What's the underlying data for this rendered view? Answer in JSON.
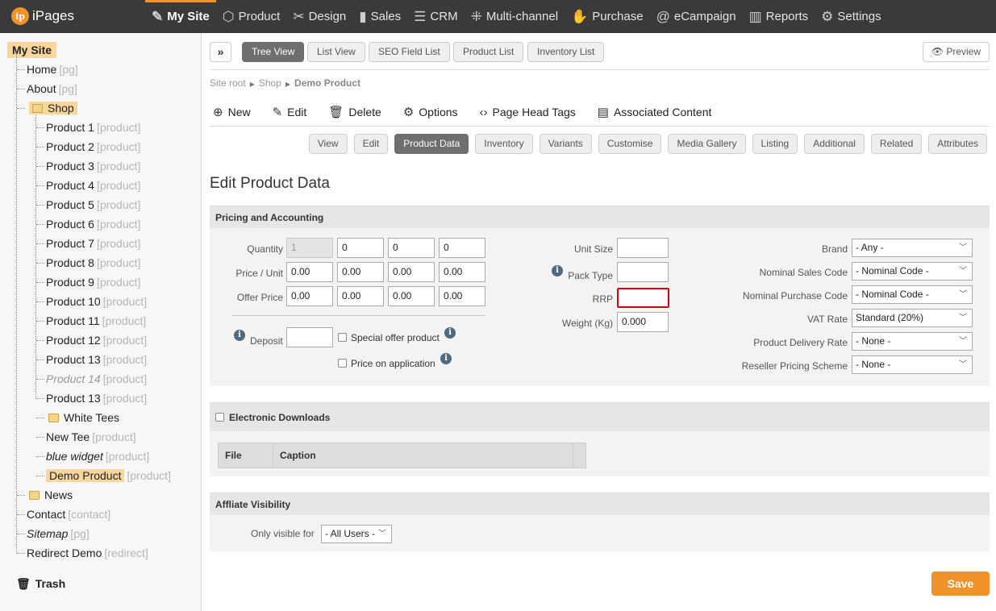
{
  "app": {
    "logo_text": "iPages",
    "logo_mark": "ip",
    "accent": "#f0922a"
  },
  "nav": [
    {
      "label": "My Site",
      "icon": "my-site-icon",
      "glyph": "✎",
      "active": true
    },
    {
      "label": "Product",
      "icon": "box-icon",
      "glyph": "⬡"
    },
    {
      "label": "Design",
      "icon": "brush-icon",
      "glyph": "✂"
    },
    {
      "label": "Sales",
      "icon": "bar-chart-icon",
      "glyph": "▮"
    },
    {
      "label": "CRM",
      "icon": "contact-card-icon",
      "glyph": "☰"
    },
    {
      "label": "Multi-channel",
      "icon": "network-icon",
      "glyph": "⁜"
    },
    {
      "label": "Purchase",
      "icon": "handshake-icon",
      "glyph": "✋"
    },
    {
      "label": "eCampaign",
      "icon": "at-icon",
      "glyph": "@"
    },
    {
      "label": "Reports",
      "icon": "reports-icon",
      "glyph": "▥"
    },
    {
      "label": "Settings",
      "icon": "gear-icon",
      "glyph": "⚙"
    }
  ],
  "tree": {
    "root": "My Site",
    "nodes": [
      {
        "label": "Home",
        "tag": "[pg]"
      },
      {
        "label": "About",
        "tag": "[pg]"
      },
      {
        "label": "Shop",
        "tag": ""
      },
      {
        "label": "Product 1",
        "tag": "[product]"
      },
      {
        "label": "Product 2",
        "tag": "[product]"
      },
      {
        "label": "Product 3",
        "tag": "[product]"
      },
      {
        "label": "Product 4",
        "tag": "[product]"
      },
      {
        "label": "Product 5",
        "tag": "[product]"
      },
      {
        "label": "Product 6",
        "tag": "[product]"
      },
      {
        "label": "Product 7",
        "tag": "[product]"
      },
      {
        "label": "Product 8",
        "tag": "[product]"
      },
      {
        "label": "Product 9",
        "tag": "[product]"
      },
      {
        "label": "Product 10",
        "tag": "[product]"
      },
      {
        "label": "Product 11",
        "tag": "[product]"
      },
      {
        "label": "Product 12",
        "tag": "[product]"
      },
      {
        "label": "Product 13",
        "tag": "[product]"
      },
      {
        "label": "Product 14",
        "tag": "[product]"
      },
      {
        "label": "Product 13",
        "tag": "[product]"
      },
      {
        "label": "White Tees",
        "tag": ""
      },
      {
        "label": "New Tee",
        "tag": "[product]"
      },
      {
        "label": "blue widget",
        "tag": "[product]"
      },
      {
        "label": "Demo Product",
        "tag": "[product]"
      },
      {
        "label": "News",
        "tag": ""
      },
      {
        "label": "Contact",
        "tag": "[contact]"
      },
      {
        "label": "Sitemap",
        "tag": "[pg]"
      },
      {
        "label": "Redirect Demo",
        "tag": "[redirect]"
      }
    ],
    "trash": "Trash"
  },
  "view_tabs": [
    "Tree View",
    "List View",
    "SEO Field List",
    "Product List",
    "Inventory List"
  ],
  "preview": "Preview",
  "breadcrumb": [
    "Site root",
    "Shop",
    "Demo Product"
  ],
  "actions": [
    {
      "label": "New",
      "glyph": "⊕"
    },
    {
      "label": "Edit",
      "glyph": "✎"
    },
    {
      "label": "Delete",
      "glyph": "🗑"
    },
    {
      "label": "Options",
      "glyph": "⚙"
    },
    {
      "label": "Page Head Tags",
      "glyph": "‹›"
    },
    {
      "label": "Associated Content",
      "glyph": "▤"
    }
  ],
  "sub_tabs": [
    "View",
    "Edit",
    "Product Data",
    "Inventory",
    "Variants",
    "Customise",
    "Media Gallery",
    "Listing",
    "Additional",
    "Related",
    "Attributes"
  ],
  "page_title": "Edit Product Data",
  "pricing": {
    "heading": "Pricing and Accounting",
    "quantity_label": "Quantity",
    "price_label": "Price / Unit",
    "offer_label": "Offer Price",
    "quantity": [
      "1",
      "0",
      "0",
      "0"
    ],
    "price": [
      "0.00",
      "0.00",
      "0.00",
      "0.00"
    ],
    "offer": [
      "0.00",
      "0.00",
      "0.00",
      "0.00"
    ],
    "deposit_label": "Deposit",
    "deposit": "",
    "special_offer": "Special offer product",
    "price_on_app": "Price on application",
    "unit_size_label": "Unit Size",
    "pack_type_label": "Pack Type",
    "rrp_label": "RRP",
    "weight_label": "Weight (Kg)",
    "unit_size": "",
    "pack_type": "",
    "rrp": "",
    "weight": "0.000",
    "brand_label": "Brand",
    "brand": "- Any -",
    "nominal_sales_label": "Nominal Sales Code",
    "nominal_sales": "- Nominal Code -",
    "nominal_purchase_label": "Nominal Purchase Code",
    "nominal_purchase": "- Nominal Code -",
    "vat_label": "VAT Rate",
    "vat": "Standard (20%)",
    "delivery_label": "Product Delivery Rate",
    "delivery": "- None -",
    "reseller_label": "Reseller Pricing Scheme",
    "reseller": "- None -"
  },
  "downloads": {
    "heading": "Electronic Downloads",
    "col_file": "File",
    "col_caption": "Caption"
  },
  "affiliate": {
    "heading": "Affliate Visibility",
    "label": "Only visible for",
    "value": "- All Users -"
  },
  "save": "Save"
}
